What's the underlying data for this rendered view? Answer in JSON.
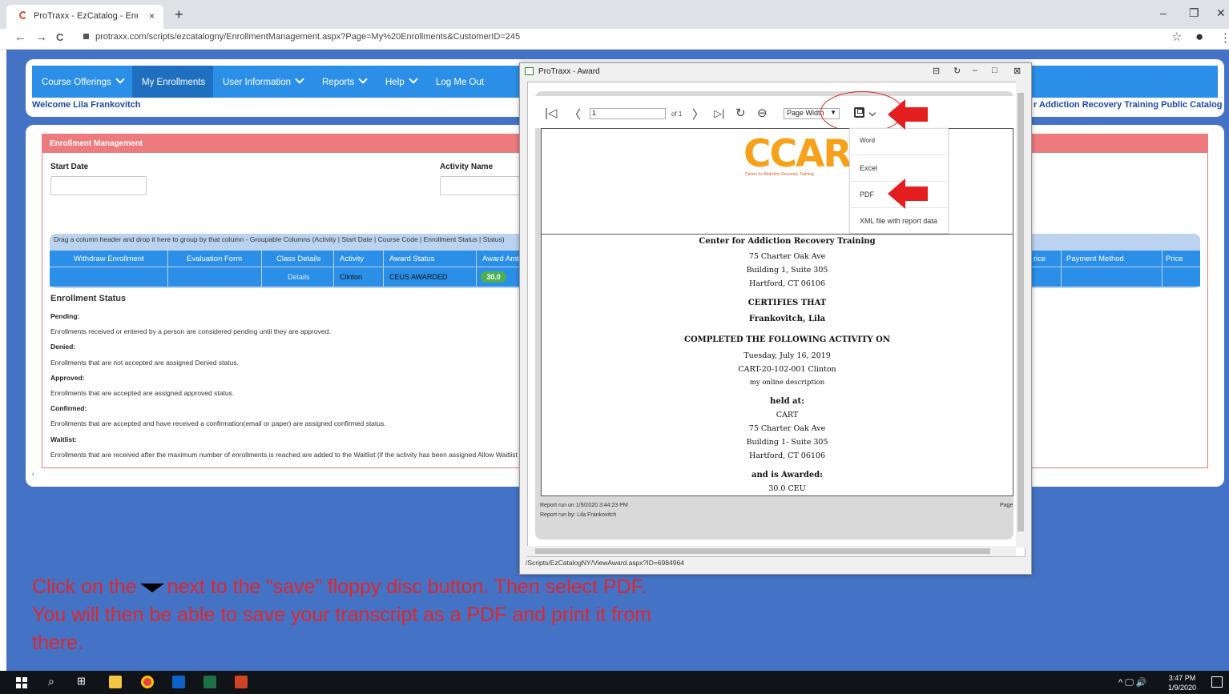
{
  "browser": {
    "tab_title": "ProTraxx - EzCatalog - Enrollmen",
    "tab_close": "×",
    "new_tab": "+",
    "url": "protraxx.com/scripts/ezcatalogny/EnrollmentManagement.aspx?Page=My%20Enrollments&CustomerID=245",
    "back": "←",
    "forward": "→",
    "reload": "C",
    "minimize": "–",
    "restore": "❐",
    "close": "✕",
    "star": "☆",
    "menu": "⋮",
    "profile": "●"
  },
  "nav": {
    "items": [
      {
        "label": "Course Offerings"
      },
      {
        "label": "My Enrollments"
      },
      {
        "label": "User Information"
      },
      {
        "label": "Reports"
      },
      {
        "label": "Help"
      },
      {
        "label": "Log Me Out"
      }
    ],
    "welcome": "Welcome Lila Frankovitch",
    "catalog_title": "r Addiction Recovery Training Public Catalog"
  },
  "enrollment": {
    "header": "Enrollment Management",
    "start_date_label": "Start Date",
    "activity_name_label": "Activity Name",
    "group_hint": "Drag a column header and drop it here to group by that column - Groupable Columns (Activity | Start Date | Course Code | Enrollment Status | Status)",
    "columns": [
      "Withdraw Enrollment",
      "Evaluation Form",
      "Class Details",
      "Activity",
      "Award Status",
      "Award Amt",
      "rice",
      "Payment Method",
      "Price"
    ],
    "row": {
      "class_details": "Details",
      "activity": "Clinton",
      "award_status": "CEUS AWARDED",
      "award_amt": "30.0"
    },
    "status_title": "Enrollment Status",
    "statuses": [
      {
        "term": "Pending:",
        "desc": "Enrollments received or entered by a person are considered pending until they are approved."
      },
      {
        "term": "Denied:",
        "desc": "Enrollments that are not accepted are assigned Denied status."
      },
      {
        "term": "Approved:",
        "desc": "Enrollments that are accepted are assigned approved status."
      },
      {
        "term": "Confirmed:",
        "desc": "Enrollments that are accepted and have received a confirmation(email or paper) are assigned confirmed status."
      },
      {
        "term": "Waitlist:",
        "desc": "Enrollments that are received after the maximum number of enrollments is reached are added to the Waitlist (if the activity has been assigned Allow Waitlist"
      }
    ],
    "scroll_left": "‹"
  },
  "popup": {
    "title": "ProTraxx - Award",
    "page_value": "1",
    "of_label": "of 1",
    "zoom": "Page Width",
    "export_options": [
      "Word",
      "Excel",
      "PDF",
      "XML file with report data"
    ],
    "status_url": "/Scripts/EzCatalogNY/ViewAward.aspx?ID=6984964",
    "logo_text": "CCAR",
    "logo_subtext": "Center for Addiction Recovery Training",
    "report": {
      "org": "Center for Addiction Recovery Training",
      "addr1": "75 Charter Oak Ave",
      "addr2": "Building 1, Suite 305",
      "addr3": "Hartford, CT  06106",
      "certifies": "CERTIFIES THAT",
      "name": "Frankovitch, Lila",
      "completed": "COMPLETED THE FOLLOWING ACTIVITY ON",
      "date": "Tuesday, July 16, 2019",
      "course": "CART-20-102-001 Clinton",
      "desc": "my online description",
      "held_at": "held at:",
      "venue": "CART",
      "vaddr1": "75 Charter Oak Ave",
      "vaddr2": "Building 1- Suite 305",
      "vaddr3": "Hartford, CT  06106",
      "awarded": "and is Awarded:",
      "ceu": "30.0 CEU",
      "run_on": "Report run on 1/9/2020 3:44:23 PM",
      "run_by": "Report run by: Lila Frankovitch",
      "page": "Page"
    }
  },
  "instruction": {
    "part1": "Click on the",
    "part2": "next to the “save” floppy disc button. Then select PDF. You will then be able to save your transcript as a PDF and print it from there."
  },
  "taskbar": {
    "time": "3:47 PM",
    "date": "1/9/2020",
    "tray": "^ 🖵 🔊"
  },
  "colors": {
    "nav": "#2b8fe8",
    "page_bg": "#4473c5",
    "header_red": "#ed7b7d",
    "annotation_red": "#e0262b"
  }
}
